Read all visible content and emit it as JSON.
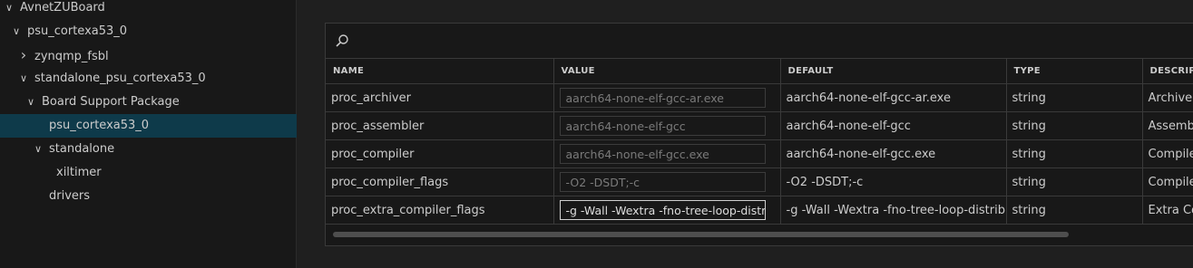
{
  "tree": [
    {
      "label": "AvnetZUBoard",
      "indent": 0,
      "chevron": "down",
      "selected": false
    },
    {
      "label": "psu_cortexa53_0",
      "indent": 1,
      "chevron": "down",
      "selected": false
    },
    {
      "label": "zynqmp_fsbl",
      "indent": 2,
      "chevron": "right",
      "selected": false
    },
    {
      "label": "standalone_psu_cortexa53_0",
      "indent": 2,
      "chevron": "down",
      "selected": false
    },
    {
      "label": "Board Support Package",
      "indent": 3,
      "chevron": "down",
      "selected": false
    },
    {
      "label": "psu_cortexa53_0",
      "indent": 4,
      "chevron": "",
      "selected": true
    },
    {
      "label": "standalone",
      "indent": 4,
      "chevron": "down",
      "selected": false
    },
    {
      "label": "xiltimer",
      "indent": 5,
      "chevron": "",
      "selected": false
    },
    {
      "label": "drivers",
      "indent": 4,
      "chevron": "",
      "selected": false
    }
  ],
  "table": {
    "headers": [
      "NAME",
      "VALUE",
      "DEFAULT",
      "TYPE",
      "DESCRIPTI"
    ],
    "rows": [
      {
        "name": "proc_archiver",
        "value": "aarch64-none-elf-gcc-ar.exe",
        "default": "aarch64-none-elf-gcc-ar.exe",
        "type": "string",
        "description": "Archiver"
      },
      {
        "name": "proc_assembler",
        "value": "aarch64-none-elf-gcc",
        "default": "aarch64-none-elf-gcc",
        "type": "string",
        "description": "Assemble"
      },
      {
        "name": "proc_compiler",
        "value": "aarch64-none-elf-gcc.exe",
        "default": "aarch64-none-elf-gcc.exe",
        "type": "string",
        "description": "Compiler"
      },
      {
        "name": "proc_compiler_flags",
        "value": " -O2 -DSDT;-c",
        "default": "-O2 -DSDT;-c",
        "type": "string",
        "description": "Compiler"
      },
      {
        "name": "proc_extra_compiler_flags",
        "value": "-g -Wall -Wextra -fno-tree-loop-distribute-patterns",
        "default": "-g -Wall -Wextra -fno-tree-loop-distribute-pa",
        "type": "string",
        "description": "Extra Con"
      }
    ]
  },
  "colors": {
    "selected": "#0e3a4a",
    "background": "#1f1f1f",
    "panel": "#181818"
  },
  "icons": {
    "search": "search-icon",
    "expanded": "chevron-down-icon",
    "collapsed": "chevron-right-icon"
  }
}
